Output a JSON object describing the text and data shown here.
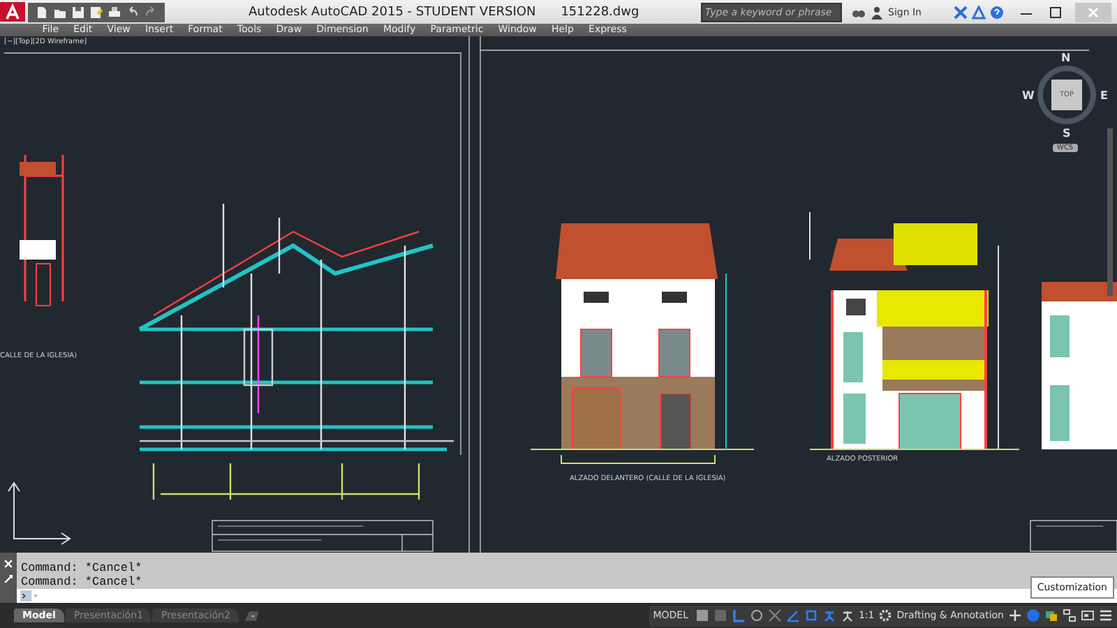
{
  "app": {
    "title": "Autodesk AutoCAD 2015 - STUDENT VERSION",
    "file": "151228.dwg"
  },
  "search": {
    "placeholder": "Type a keyword or phrase"
  },
  "sign_in": "Sign In",
  "menu": [
    "File",
    "Edit",
    "View",
    "Insert",
    "Format",
    "Tools",
    "Draw",
    "Dimension",
    "Modify",
    "Parametric",
    "Window",
    "Help",
    "Express"
  ],
  "viewport_label": "[−][Top][2D Wireframe]",
  "viewcube": {
    "north": "N",
    "south": "S",
    "east": "E",
    "west": "W",
    "face": "TOP",
    "ucs": "WCS"
  },
  "drawing_labels": [
    {
      "text": "CALLE DE LA IGLESIA)",
      "kind": "left"
    },
    {
      "text": "ALZADO DELANTERO (CALLE DE LA IGLESIA)",
      "kind": "front"
    },
    {
      "text": "ALZADO POSTERIOR",
      "kind": "rear"
    }
  ],
  "command_history": [
    "Command: *Cancel*",
    "Command: *Cancel*"
  ],
  "layout_tabs": [
    {
      "label": "Model",
      "selected": true
    },
    {
      "label": "Presentación1",
      "selected": false
    },
    {
      "label": "Presentación2",
      "selected": false
    }
  ],
  "status": {
    "model": "MODEL",
    "scale": "1:1",
    "workspace": "Drafting & Annotation"
  },
  "tooltip": "Customization"
}
